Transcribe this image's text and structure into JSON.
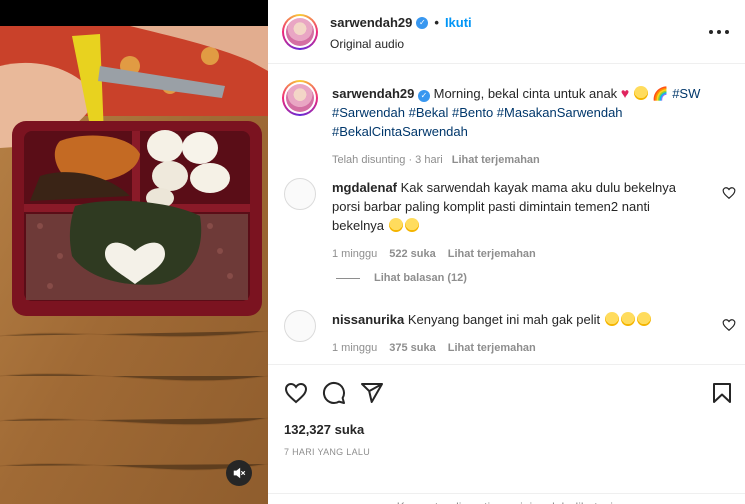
{
  "post": {
    "username": "sarwendah29",
    "follow_label": "Ikuti",
    "audio": "Original audio",
    "caption_text": "Morning, bekal cinta untuk anak",
    "hashtags": "#SW #Sarwendah #Bekal #Bento #MasakanSarwendah #BekalCintaSarwendah",
    "edited": "Telah disunting · 3 hari",
    "see_translation": "Lihat terjemahan"
  },
  "comments": [
    {
      "username": "mgdalenaf",
      "text": "Kak sarwendah kayak mama aku dulu bekelnya porsi barbar paling komplit pasti dimintain temen2 nanti bekelnya",
      "time": "1 minggu",
      "likes": "522 suka",
      "translate": "Lihat terjemahan"
    },
    {
      "username": "nissanurika",
      "text": "Kenyang banget ini mah gak pelit",
      "time": "1 minggu",
      "likes": "375 suka",
      "translate": "Lihat terjemahan"
    }
  ],
  "replies_label": "Lihat balasan (12)",
  "likes_count": "132,327 suka",
  "posted_ago": "7 HARI YANG LALU",
  "comments_closed": "Komentar di postingan ini sudah dibatasi.",
  "icons": {
    "like": "heart-icon",
    "comment": "comment-icon",
    "share": "share-icon",
    "save": "bookmark-icon",
    "mute": "muted-speaker-icon",
    "more": "more-icon"
  },
  "colors": {
    "link": "#0095f6",
    "hashtag": "#00376b",
    "muted": "#8e8e8e"
  }
}
